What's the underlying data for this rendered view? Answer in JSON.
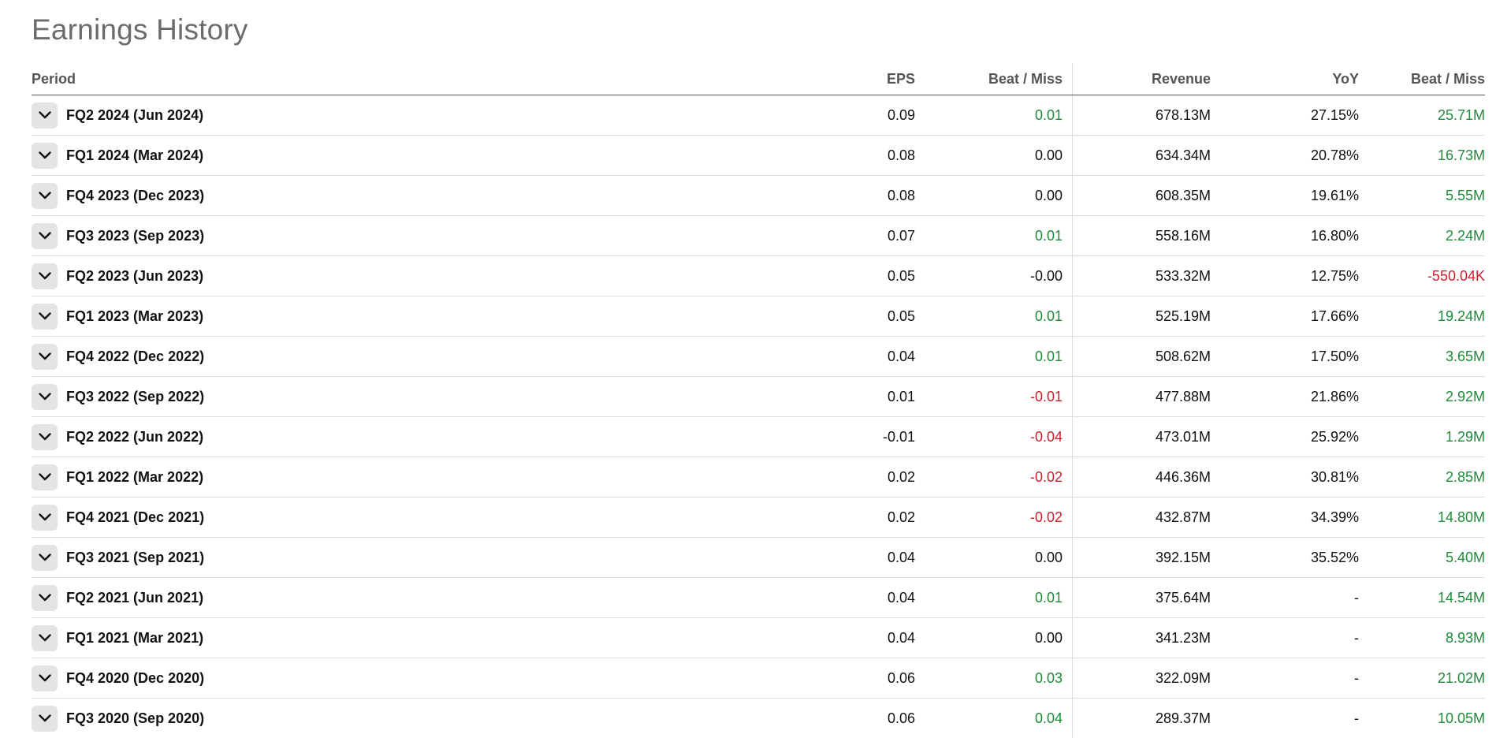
{
  "title": "Earnings History",
  "colors": {
    "positive": "#1f8a3a",
    "negative": "#cc1f2d",
    "neutral": "#111111"
  },
  "columns": {
    "period": "Period",
    "eps": "EPS",
    "eps_beat": "Beat / Miss",
    "revenue": "Revenue",
    "yoy": "YoY",
    "rev_beat": "Beat / Miss"
  },
  "rows": [
    {
      "period": "FQ2 2024 (Jun 2024)",
      "eps": "0.09",
      "eps_beat": "0.01",
      "eps_beat_tone": "pos",
      "revenue": "678.13M",
      "yoy": "27.15%",
      "rev_beat": "25.71M",
      "rev_beat_tone": "pos"
    },
    {
      "period": "FQ1 2024 (Mar 2024)",
      "eps": "0.08",
      "eps_beat": "0.00",
      "eps_beat_tone": "neu",
      "revenue": "634.34M",
      "yoy": "20.78%",
      "rev_beat": "16.73M",
      "rev_beat_tone": "pos"
    },
    {
      "period": "FQ4 2023 (Dec 2023)",
      "eps": "0.08",
      "eps_beat": "0.00",
      "eps_beat_tone": "neu",
      "revenue": "608.35M",
      "yoy": "19.61%",
      "rev_beat": "5.55M",
      "rev_beat_tone": "pos"
    },
    {
      "period": "FQ3 2023 (Sep 2023)",
      "eps": "0.07",
      "eps_beat": "0.01",
      "eps_beat_tone": "pos",
      "revenue": "558.16M",
      "yoy": "16.80%",
      "rev_beat": "2.24M",
      "rev_beat_tone": "pos"
    },
    {
      "period": "FQ2 2023 (Jun 2023)",
      "eps": "0.05",
      "eps_beat": "-0.00",
      "eps_beat_tone": "neu",
      "revenue": "533.32M",
      "yoy": "12.75%",
      "rev_beat": "-550.04K",
      "rev_beat_tone": "neg"
    },
    {
      "period": "FQ1 2023 (Mar 2023)",
      "eps": "0.05",
      "eps_beat": "0.01",
      "eps_beat_tone": "pos",
      "revenue": "525.19M",
      "yoy": "17.66%",
      "rev_beat": "19.24M",
      "rev_beat_tone": "pos"
    },
    {
      "period": "FQ4 2022 (Dec 2022)",
      "eps": "0.04",
      "eps_beat": "0.01",
      "eps_beat_tone": "pos",
      "revenue": "508.62M",
      "yoy": "17.50%",
      "rev_beat": "3.65M",
      "rev_beat_tone": "pos"
    },
    {
      "period": "FQ3 2022 (Sep 2022)",
      "eps": "0.01",
      "eps_beat": "-0.01",
      "eps_beat_tone": "neg",
      "revenue": "477.88M",
      "yoy": "21.86%",
      "rev_beat": "2.92M",
      "rev_beat_tone": "pos"
    },
    {
      "period": "FQ2 2022 (Jun 2022)",
      "eps": "-0.01",
      "eps_beat": "-0.04",
      "eps_beat_tone": "neg",
      "revenue": "473.01M",
      "yoy": "25.92%",
      "rev_beat": "1.29M",
      "rev_beat_tone": "pos"
    },
    {
      "period": "FQ1 2022 (Mar 2022)",
      "eps": "0.02",
      "eps_beat": "-0.02",
      "eps_beat_tone": "neg",
      "revenue": "446.36M",
      "yoy": "30.81%",
      "rev_beat": "2.85M",
      "rev_beat_tone": "pos"
    },
    {
      "period": "FQ4 2021 (Dec 2021)",
      "eps": "0.02",
      "eps_beat": "-0.02",
      "eps_beat_tone": "neg",
      "revenue": "432.87M",
      "yoy": "34.39%",
      "rev_beat": "14.80M",
      "rev_beat_tone": "pos"
    },
    {
      "period": "FQ3 2021 (Sep 2021)",
      "eps": "0.04",
      "eps_beat": "0.00",
      "eps_beat_tone": "neu",
      "revenue": "392.15M",
      "yoy": "35.52%",
      "rev_beat": "5.40M",
      "rev_beat_tone": "pos"
    },
    {
      "period": "FQ2 2021 (Jun 2021)",
      "eps": "0.04",
      "eps_beat": "0.01",
      "eps_beat_tone": "pos",
      "revenue": "375.64M",
      "yoy": "-",
      "rev_beat": "14.54M",
      "rev_beat_tone": "pos"
    },
    {
      "period": "FQ1 2021 (Mar 2021)",
      "eps": "0.04",
      "eps_beat": "0.00",
      "eps_beat_tone": "neu",
      "revenue": "341.23M",
      "yoy": "-",
      "rev_beat": "8.93M",
      "rev_beat_tone": "pos"
    },
    {
      "period": "FQ4 2020 (Dec 2020)",
      "eps": "0.06",
      "eps_beat": "0.03",
      "eps_beat_tone": "pos",
      "revenue": "322.09M",
      "yoy": "-",
      "rev_beat": "21.02M",
      "rev_beat_tone": "pos"
    },
    {
      "period": "FQ3 2020 (Sep 2020)",
      "eps": "0.06",
      "eps_beat": "0.04",
      "eps_beat_tone": "pos",
      "revenue": "289.37M",
      "yoy": "-",
      "rev_beat": "10.05M",
      "rev_beat_tone": "pos"
    }
  ],
  "icons": {
    "expand": "chevron-down-icon"
  }
}
